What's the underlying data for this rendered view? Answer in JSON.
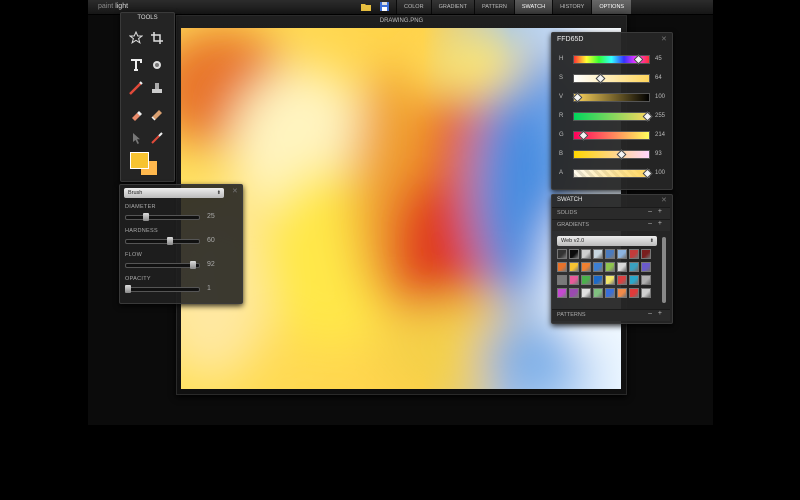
{
  "app": {
    "brand_part1": "paint",
    "brand_part2": "light",
    "menu": [
      {
        "label": "COLOR",
        "state": "normal"
      },
      {
        "label": "GRADIENT",
        "state": "normal"
      },
      {
        "label": "PATTERN",
        "state": "normal"
      },
      {
        "label": "SWATCH",
        "state": "active"
      },
      {
        "label": "HISTORY",
        "state": "normal"
      },
      {
        "label": "OPTIONS",
        "state": "options"
      }
    ]
  },
  "canvas": {
    "title": "DRAWING.PNG"
  },
  "tools": {
    "title": "TOOLS",
    "items": [
      "star-shape-icon",
      "crop-icon",
      "text-icon",
      "pattern-stamp-icon",
      "brush-icon",
      "clone-stamp-icon",
      "eraser-icon",
      "smudge-icon",
      "selection-arrow-icon",
      "eyedropper-icon"
    ],
    "foreground": "#f7c331",
    "background": "#ffb84d"
  },
  "brush": {
    "preset": "Brush",
    "sliders": [
      {
        "label": "DIAMETER",
        "value": "25",
        "fraction": 0.28
      },
      {
        "label": "HARDNESS",
        "value": "60",
        "fraction": 0.6
      },
      {
        "label": "FLOW",
        "value": "92",
        "fraction": 0.92
      },
      {
        "label": "OPACITY",
        "value": "1",
        "fraction": 0.03
      }
    ]
  },
  "color": {
    "hex": "FFD65D",
    "channels": [
      {
        "label": "H",
        "value": "45"
      },
      {
        "label": "S",
        "value": "64"
      },
      {
        "label": "V",
        "value": "100"
      },
      {
        "label": "R",
        "value": "255"
      },
      {
        "label": "G",
        "value": "214"
      },
      {
        "label": "B",
        "value": "93"
      },
      {
        "label": "A",
        "value": "100"
      }
    ]
  },
  "swatch": {
    "title": "SWATCH",
    "sections": [
      "SOLIDS",
      "GRADIENTS",
      "PATTERNS"
    ],
    "add_remove": "– +",
    "set": "Web v2.0",
    "cells": [
      "#333333",
      "#0b0b0b",
      "#cfcfcf",
      "#c8d6e0",
      "#4a7bbf",
      "#8db4e0",
      "#c23b3b",
      "#7a1e1e",
      "#e8722a",
      "#f7c331",
      "#f08030",
      "#3d7fd1",
      "#8fc44e",
      "#d9d9d9",
      "#3aa0c0",
      "#6a5acd",
      "#7a7a7a",
      "#e85a9a",
      "#4ab04a",
      "#1d6ac7",
      "#f1e56a",
      "#d94141",
      "#2aa7c9",
      "#b0b0b0",
      "#c44ad0",
      "#9a4ab0",
      "#e0e0e0",
      "#80c080",
      "#3a6fd8",
      "#f08a4a",
      "#e03a3a",
      "#d0d0d0"
    ]
  }
}
